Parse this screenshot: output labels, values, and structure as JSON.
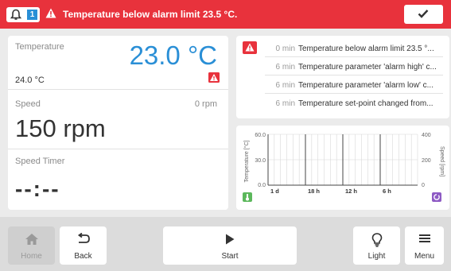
{
  "alarm": {
    "count": "1",
    "message": "Temperature below alarm limit 23.5 °C."
  },
  "temperature": {
    "label": "Temperature",
    "value": "23.0 °C",
    "setpoint": "24.0 °C"
  },
  "speed": {
    "label": "Speed",
    "actual": "0 rpm",
    "value": "150 rpm"
  },
  "timer": {
    "label": "Speed Timer",
    "value": "--:--"
  },
  "events": [
    {
      "time": "0 min",
      "text": "Temperature below alarm limit 23.5 °..."
    },
    {
      "time": "6 min",
      "text": "Temperature parameter 'alarm high' c..."
    },
    {
      "time": "6 min",
      "text": "Temperature parameter 'alarm low' c..."
    },
    {
      "time": "6 min",
      "text": "Temperature set-point changed from..."
    }
  ],
  "chart_data": {
    "type": "line",
    "xlabel": "",
    "x_ticks": [
      "1 d",
      "18 h",
      "12 h",
      "6 h"
    ],
    "left_axis": {
      "label": "Temperature [°C]",
      "ticks": [
        "60.0",
        "30.0",
        "0.0"
      ],
      "range": [
        0,
        60
      ]
    },
    "right_axis": {
      "label": "Speed [rpm]",
      "ticks": [
        "400",
        "200",
        "0"
      ],
      "range": [
        0,
        400
      ]
    },
    "series": [],
    "grid": true,
    "colors": {
      "temperature": "#5cb85c",
      "speed": "#8e5bc4"
    }
  },
  "nav": {
    "home": "Home",
    "back": "Back",
    "start": "Start",
    "light": "Light",
    "menu": "Menu"
  },
  "colors": {
    "alarm": "#e8323c",
    "accent": "#2a8fd6"
  }
}
